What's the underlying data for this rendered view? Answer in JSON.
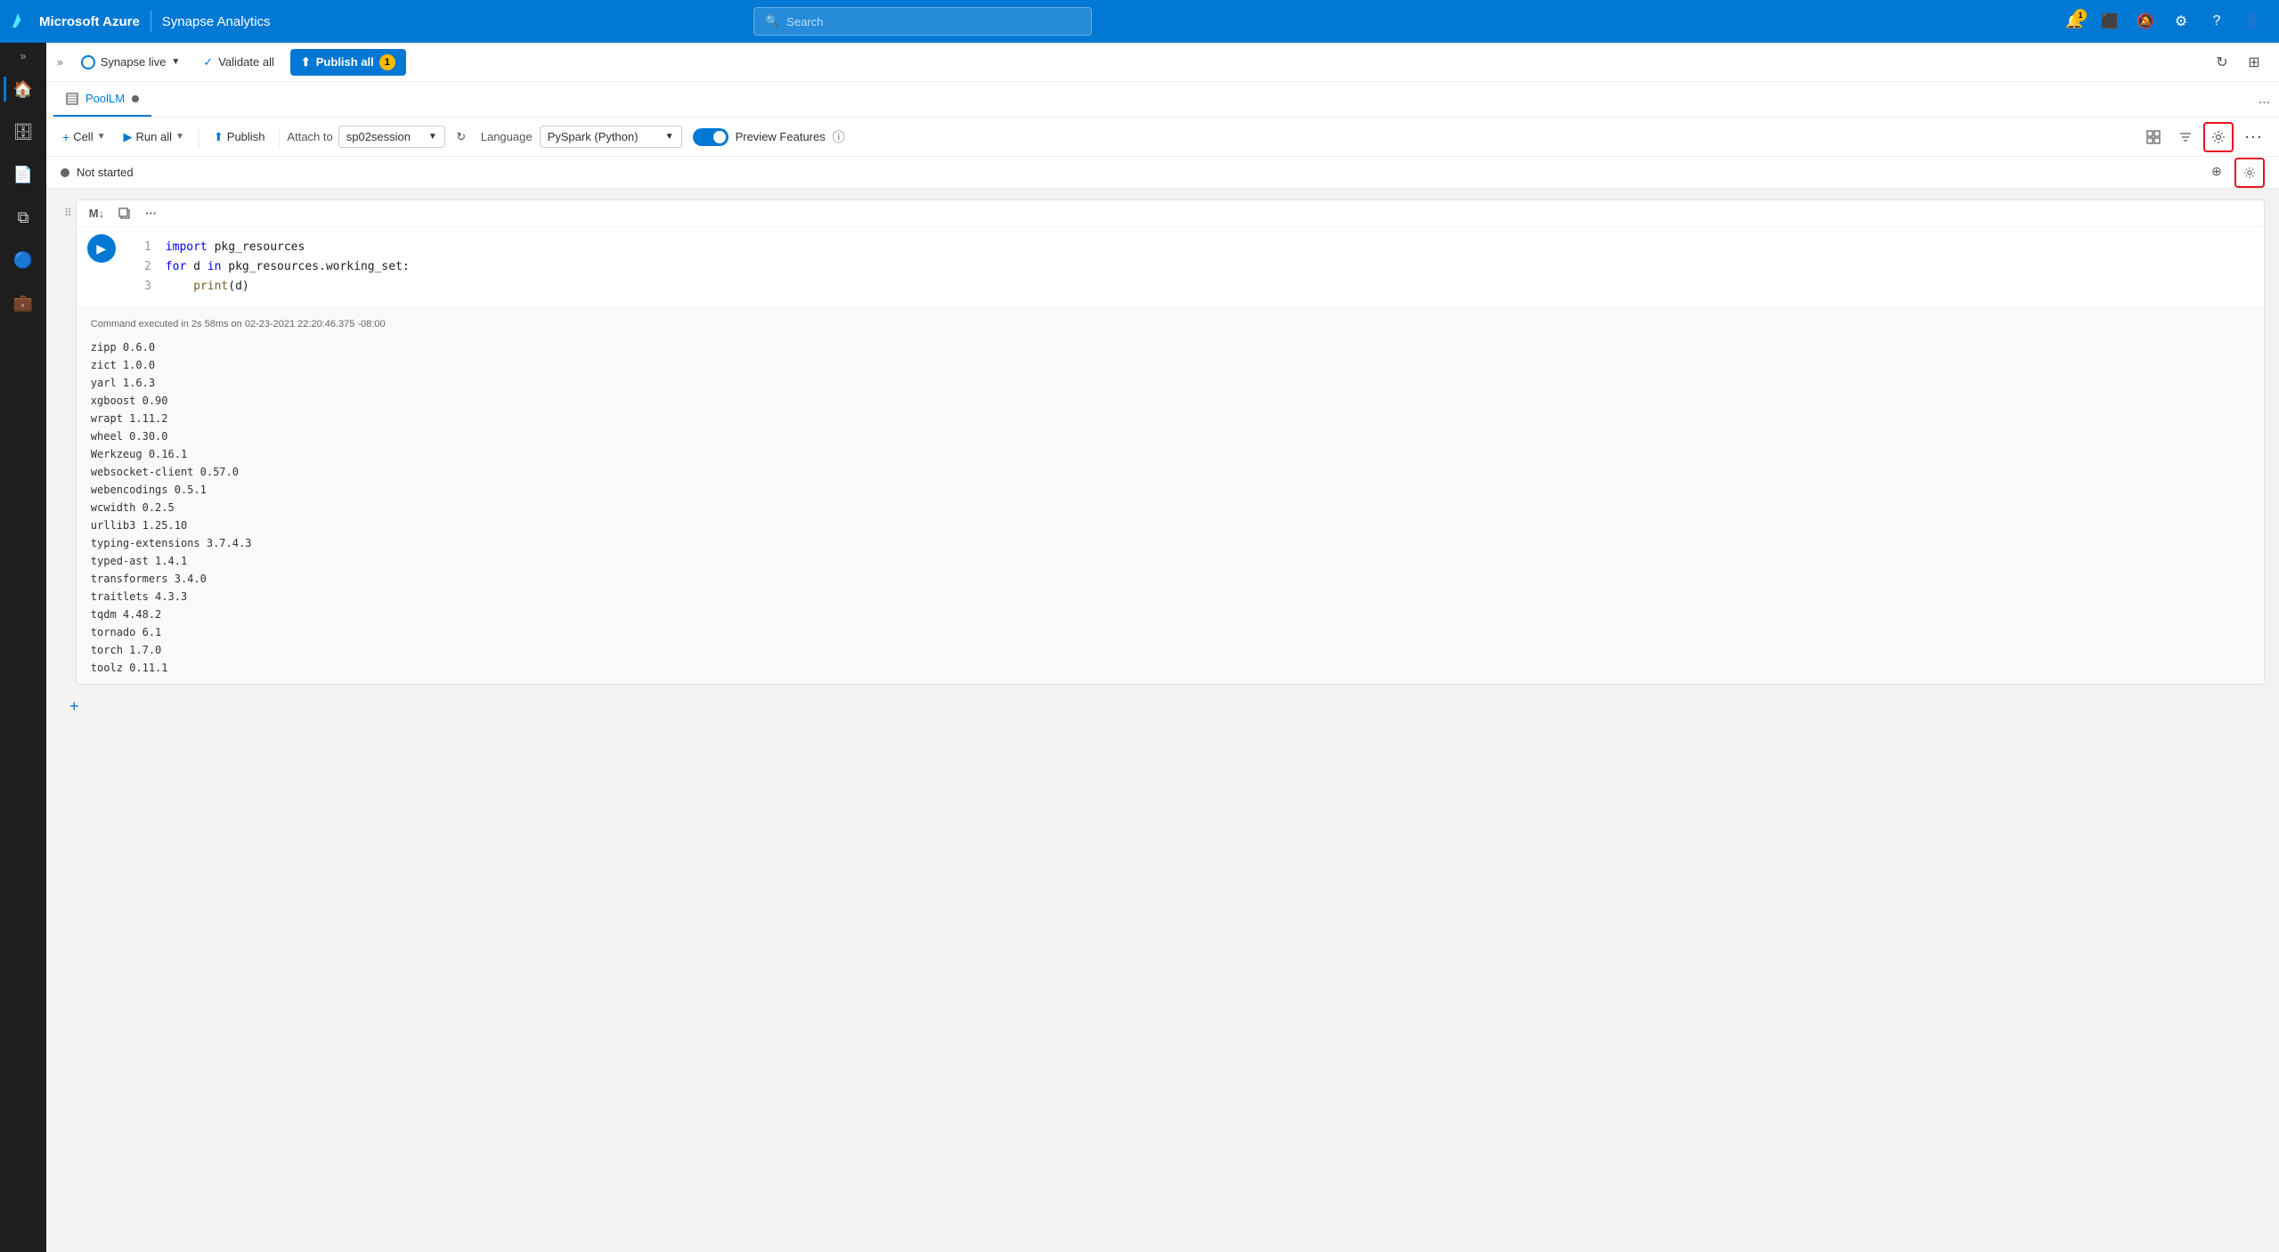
{
  "topbar": {
    "brand": "Microsoft Azure",
    "divider": "|",
    "app": "Synapse Analytics",
    "search_placeholder": "Search",
    "notification_count": "1"
  },
  "subtoolbar": {
    "expand_label": "»",
    "synapse_live": "Synapse live",
    "validate_all": "Validate all",
    "publish_all": "Publish all",
    "publish_badge": "1"
  },
  "tabs": {
    "items": [
      {
        "label": "PoolLM",
        "active": true,
        "dot": true
      }
    ],
    "more": "..."
  },
  "notebook_toolbar": {
    "cell_label": "Cell",
    "run_all": "Run all",
    "publish": "Publish",
    "attach_to": "Attach to",
    "attach_value": "sp02session",
    "refresh_label": "↻",
    "language_label": "Language",
    "language_value": "PySpark (Python)",
    "preview_features": "Preview Features",
    "info_icon": "ⓘ",
    "notebook_view": "⊞",
    "filter_icon": "⊟",
    "more": "..."
  },
  "status": {
    "text": "Not started"
  },
  "cell": {
    "lines": [
      "1",
      "2",
      "3"
    ],
    "code_line1": "import pkg_resources",
    "code_line2": "for d in pkg_resources.working_set:",
    "code_line3": "    print(d)",
    "output_meta": "Command executed in 2s 58ms on 02-23-2021 22:20:46.375 -08:00",
    "output_lines": [
      "zipp 0.6.0",
      "zict 1.0.0",
      "yarl 1.6.3",
      "xgboost 0.90",
      "wrapt 1.11.2",
      "wheel 0.30.0",
      "Werkzeug 0.16.1",
      "websocket-client 0.57.0",
      "webencodings 0.5.1",
      "wcwidth 0.2.5",
      "urllib3 1.25.10",
      "typing-extensions 3.7.4.3",
      "typed-ast 1.4.1",
      "transformers 3.4.0",
      "traitlets 4.3.3",
      "tqdm 4.48.2",
      "tornado 6.1",
      "torch 1.7.0",
      "toolz 0.11.1"
    ]
  },
  "add_cell": "+"
}
